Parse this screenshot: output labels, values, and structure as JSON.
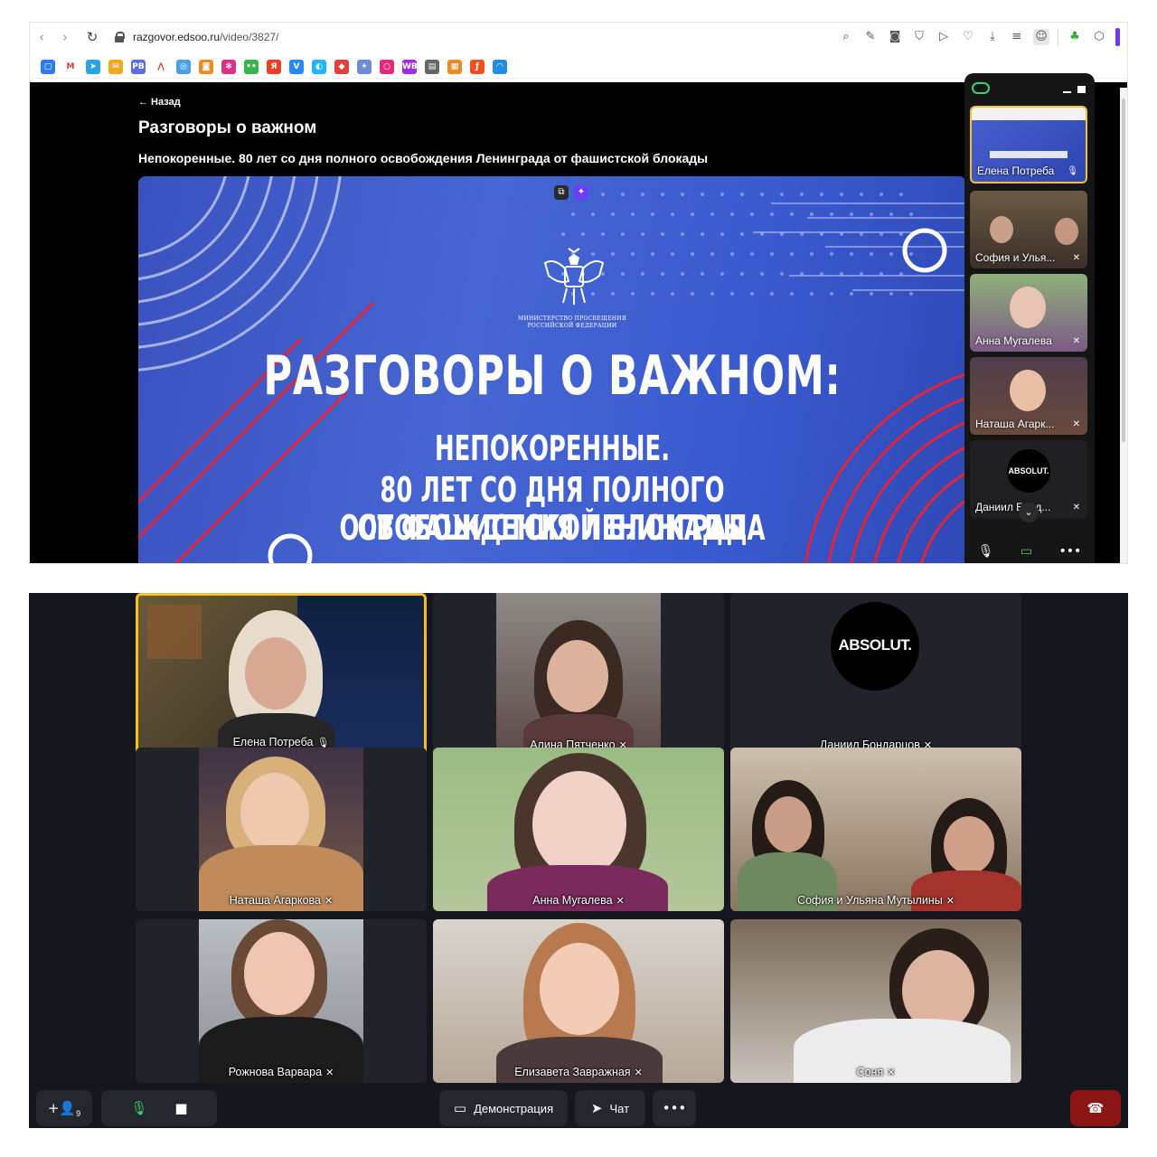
{
  "browser": {
    "url_domain": "razgovor.edsoo.ru",
    "url_path": "/video/3827/",
    "nav": {
      "back": "‹",
      "forward": "›",
      "reload": "↻"
    },
    "toolbar_icons": [
      "zoom-icon",
      "edit-icon",
      "camera-icon",
      "shield-icon",
      "send-icon",
      "heart-icon",
      "download-icon",
      "menu-icon",
      "profile-icon",
      "extension-icon",
      "cube-icon"
    ],
    "bookmarks": [
      {
        "name": "messenger",
        "color": "#2c7bf2",
        "glyph": "▢"
      },
      {
        "name": "gmail",
        "color": "#ffffff",
        "glyph": "M"
      },
      {
        "name": "telegram",
        "color": "#2aa3e0",
        "glyph": "➤"
      },
      {
        "name": "mail",
        "color": "#f5a623",
        "glyph": "✉"
      },
      {
        "name": "pb",
        "color": "#5b6ee1",
        "glyph": "PB"
      },
      {
        "name": "yandex-lavka",
        "color": "#ffffff",
        "glyph": "⋀"
      },
      {
        "name": "globe",
        "color": "#4aa0e6",
        "glyph": "◎"
      },
      {
        "name": "orange",
        "color": "#f08a24",
        "glyph": "◙"
      },
      {
        "name": "flower",
        "color": "#d8338c",
        "glyph": "✻"
      },
      {
        "name": "dots",
        "color": "#3cb44b",
        "glyph": "••"
      },
      {
        "name": "yandex",
        "color": "#f23c24",
        "glyph": "Я"
      },
      {
        "name": "vk",
        "color": "#2787f5",
        "glyph": "V"
      },
      {
        "name": "chat",
        "color": "#1fb6ff",
        "glyph": "◐"
      },
      {
        "name": "pin",
        "color": "#e0413a",
        "glyph": "◆"
      },
      {
        "name": "eagle",
        "color": "#6e8ad8",
        "glyph": "✦"
      },
      {
        "name": "oz",
        "color": "#e6287a",
        "glyph": "○"
      },
      {
        "name": "wb",
        "color": "#a12ae6",
        "glyph": "WB"
      },
      {
        "name": "doc",
        "color": "#666666",
        "glyph": "▤"
      },
      {
        "name": "grid",
        "color": "#e98b2a",
        "glyph": "▦"
      },
      {
        "name": "figma",
        "color": "#f24e1e",
        "glyph": "ƒ"
      },
      {
        "name": "edge",
        "color": "#1f8de0",
        "glyph": "◠"
      }
    ]
  },
  "page": {
    "back_label": "← Назад",
    "title": "Разговоры о важном",
    "subtitle": "Непокоренные. 80 лет со дня полного освобождения Ленинграда от фашистской блокады"
  },
  "video": {
    "ministry_line1": "МИНИСТЕРСТВО ПРОСВЕЩЕНИЯ",
    "ministry_line2": "РОССИЙСКОЙ ФЕДЕРАЦИИ",
    "title": "РАЗГОВОРЫ О ВАЖНОМ:",
    "line1": "НЕПОКОРЕННЫЕ.",
    "line2": "80 ЛЕТ СО ДНЯ ПОЛНОГО ОСВОБОЖДЕНИЯ ЛЕНИНГРАДА",
    "line3": "ОТ ФАШИСТСКОЙ БЛОКАДЫ",
    "ctrl_pip": "⧉",
    "ctrl_ai": "✦"
  },
  "mini_meeting": {
    "tiles": [
      {
        "label": "Елена Потреба",
        "mic": "🎙"
      },
      {
        "label": "София и Улья...",
        "mic": "✕"
      },
      {
        "label": "Анна Мугалева",
        "mic": "✕"
      },
      {
        "label": "Наташа Агарк...",
        "mic": "✕"
      },
      {
        "label": "Даниил Бонд...",
        "mic": "✕",
        "avatar": "ABSOLUT."
      }
    ],
    "scroll": "⌄",
    "bar": {
      "mic": "🎙",
      "screen": "▭",
      "more": "•••"
    }
  },
  "meeting": {
    "participants": [
      {
        "name": "Елена Потреба",
        "mic": "🎙"
      },
      {
        "name": "Алина Пятченко",
        "mic": "✕"
      },
      {
        "name": "Даниил Бондарцов",
        "mic": "✕",
        "avatar": "ABSOLUT."
      },
      {
        "name": "Наташа Агаркова",
        "mic": "✕"
      },
      {
        "name": "Анна Мугалева",
        "mic": "✕"
      },
      {
        "name": "София и Ульяна Мутылины",
        "mic": "✕"
      },
      {
        "name": "Рожнова Варвара",
        "mic": "✕"
      },
      {
        "name": "Елизавета Завражная",
        "mic": "✕"
      },
      {
        "name": "Соня",
        "mic": "✕"
      }
    ],
    "toolbar": {
      "add_participant": "+👤",
      "participant_count": "9",
      "mic": "🎙",
      "camera": "■",
      "share_label": "Демонстрация",
      "chat_label": "Чат",
      "more": "•••",
      "end_call": "☎"
    }
  },
  "colors": {
    "meeting_bg": "#16161e",
    "active_speaker": "#f6c223",
    "end_call": "#8b1414",
    "mic_on": "#3dd36b"
  }
}
